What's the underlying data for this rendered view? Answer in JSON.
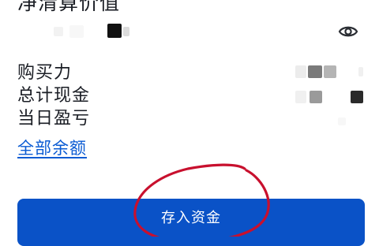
{
  "header": {
    "title": "净清算价值"
  },
  "balance": {
    "value_hidden": true,
    "visibility_icon": "eye-icon"
  },
  "details": {
    "rows": [
      {
        "label": "购买力",
        "value_hidden": true
      },
      {
        "label": "总计现金",
        "value_hidden": true
      },
      {
        "label": "当日盈亏",
        "value_hidden": true
      }
    ]
  },
  "links": {
    "all_balances": "全部余额"
  },
  "actions": {
    "deposit_label": "存入资金"
  },
  "colors": {
    "primary_button": "#0a52c7",
    "link": "#0a5bd3",
    "text": "#1a1d24",
    "annotation_ring": "#c8102e"
  }
}
